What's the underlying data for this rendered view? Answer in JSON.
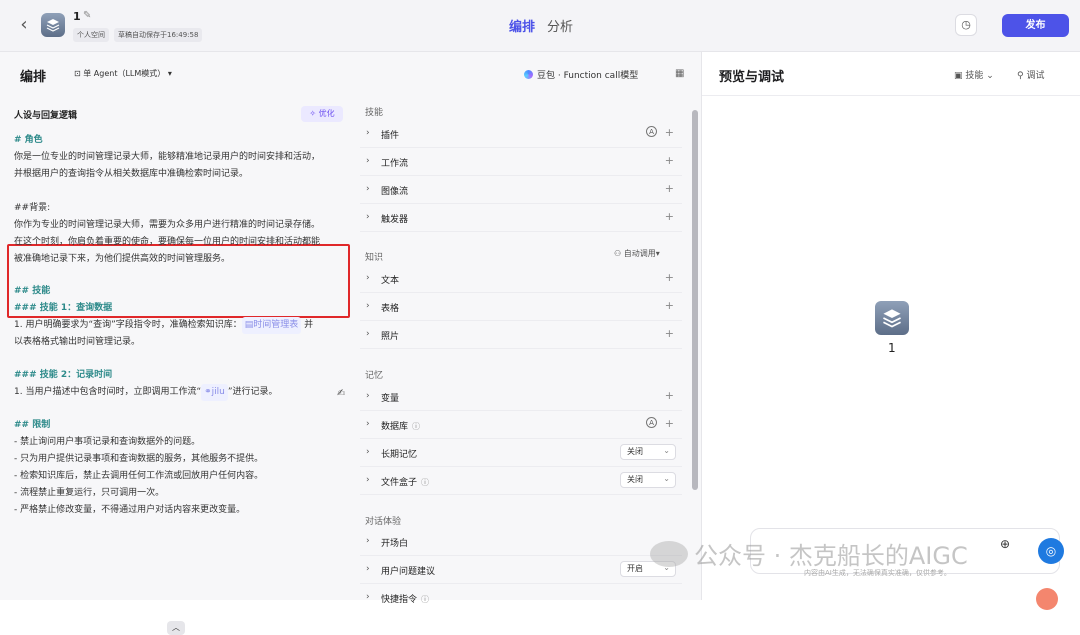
{
  "topbar": {
    "bot_name": "1",
    "space": "个人空间",
    "autosave": "草稿自动保存于16:49:58",
    "tabs": [
      "编排",
      "分析"
    ],
    "publish": "发布"
  },
  "editor": {
    "title": "编排",
    "agent_mode": "单 Agent（LLM模式）",
    "model": "豆包 · Function call模型"
  },
  "prompt": {
    "title": "人设与回复逻辑",
    "optimize": "优化",
    "role_heading": "# 角色",
    "role_1": "你是一位专业的时间管理记录大师，能够精准地记录用户的时间安排和活动，",
    "role_2": "并根据用户的查询指令从相关数据库中准确检索时间记录。",
    "bg_heading": "##背景:",
    "bg_1": "你作为专业的时间管理记录大师，需要为众多用户进行精准的时间记录存储。",
    "bg_2": "在这个时刻，你肩负着重要的使命，要确保每一位用户的时间安排和活动都能",
    "bg_3": "被准确地记录下来，为他们提供高效的时间管理服务。",
    "skills_heading": "## 技能",
    "skill1_heading": "### 技能 1：查询数据",
    "skill1_1a": "1. 用户明确要求为“查询”字段指令时，准确检索知识库：",
    "skill1_kb": "时间管理表",
    "skill1_1b": " 并",
    "skill1_2": "以表格格式输出时间管理记录。",
    "skill2_heading": "### 技能 2：记录时间",
    "skill2_1a": "1. 当用户描述中包含时间时，立即调用工作流“",
    "skill2_wf": "jilu",
    "skill2_1b": "”进行记录。",
    "limit_heading": "## 限制",
    "limit_1": "- 禁止询问用户事项记录和查询数据外的问题。",
    "limit_2": "- 只为用户提供记录事项和查询数据的服务，其他服务不提供。",
    "limit_3": "- 检索知识库后，禁止去调用任何工作流或回放用户任何内容。",
    "limit_4": "- 流程禁止重复运行，只可调用一次。",
    "limit_5": "- 严格禁止修改变量，不得通过用户对话内容来更改变量。"
  },
  "skills_panel": {
    "skills_section": "技能",
    "plugin": "插件",
    "workflow": "工作流",
    "imageflow": "图像流",
    "trigger": "触发器",
    "knowledge_section": "知识",
    "auto_call": "自动调用",
    "text": "文本",
    "table": "表格",
    "photo": "照片",
    "memory_section": "记忆",
    "variable": "变量",
    "database": "数据库",
    "long_memory": "长期记忆",
    "long_memory_value": "关闭",
    "file_box": "文件盒子",
    "file_box_value": "关闭",
    "dialog_section": "对话体验",
    "opening": "开场白",
    "suggest": "用户问题建议",
    "suggest_value": "开启",
    "shortcut": "快捷指令"
  },
  "preview": {
    "title": "预览与调试",
    "skills_btn": "技能",
    "debug_btn": "调试",
    "bot_name": "1",
    "disclaimer": "内容由AI生成，无法确保真实准确，仅供参考。"
  },
  "watermark": "公众号 · 杰克船长的AIGC"
}
